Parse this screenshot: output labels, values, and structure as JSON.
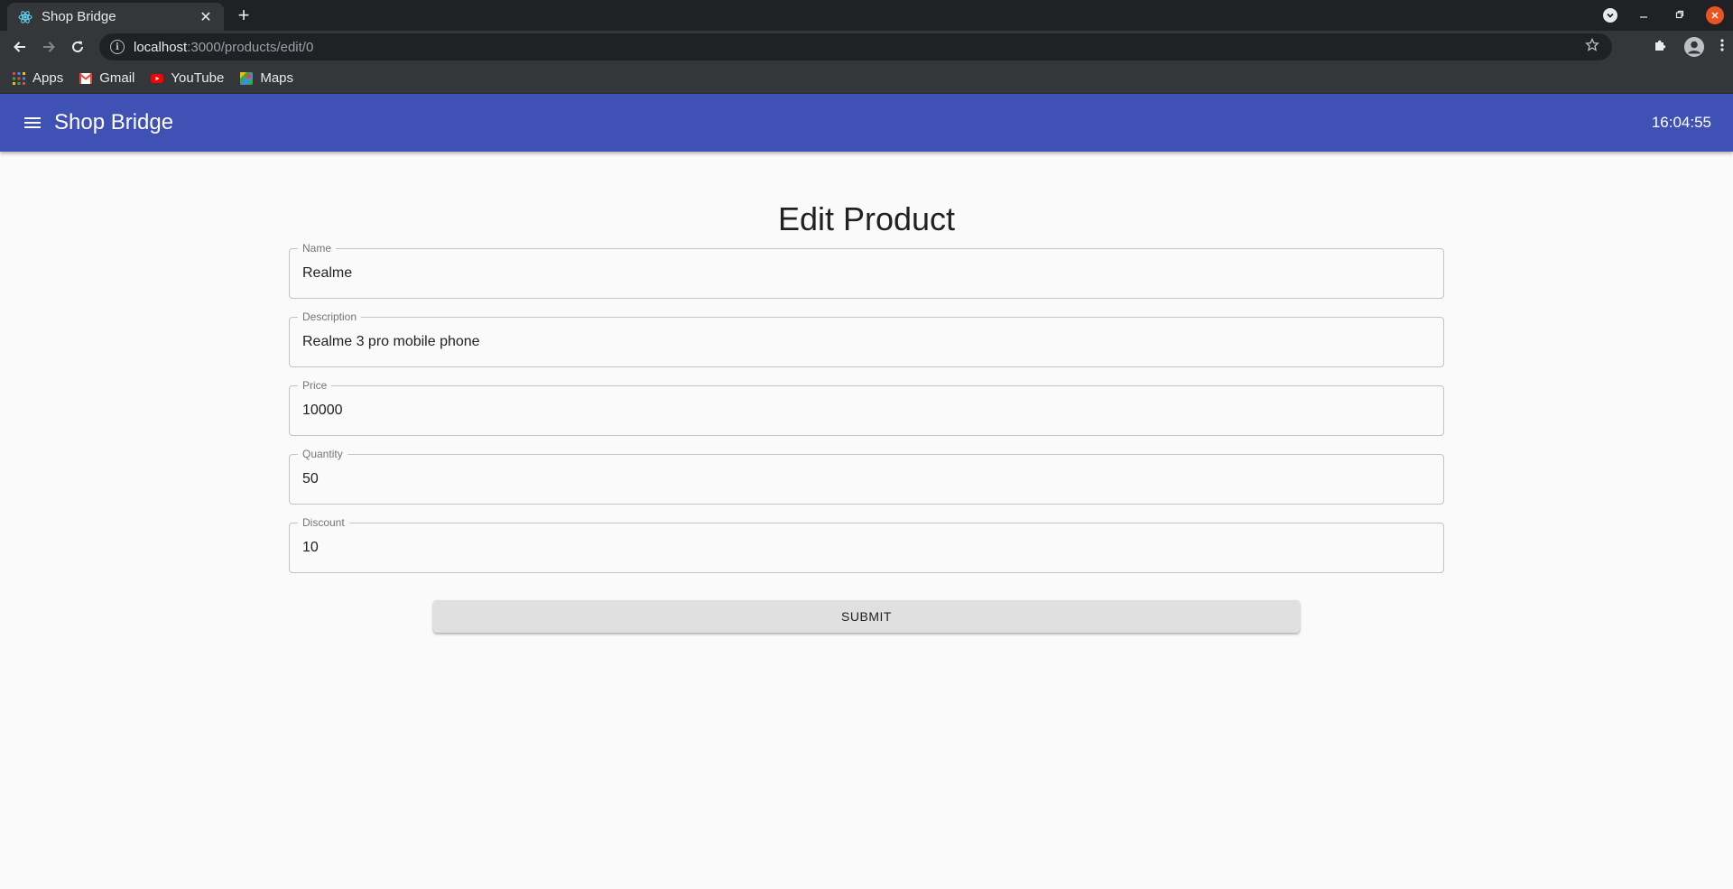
{
  "browser": {
    "tab_title": "Shop Bridge",
    "tab_close": "✕",
    "new_tab": "+",
    "url_host": "localhost",
    "url_path": ":3000/products/edit/0",
    "bookmarks": [
      {
        "label": "Apps",
        "icon": "apps-grid-icon"
      },
      {
        "label": "Gmail",
        "icon": "gmail-icon"
      },
      {
        "label": "YouTube",
        "icon": "youtube-icon"
      },
      {
        "label": "Maps",
        "icon": "maps-icon"
      }
    ]
  },
  "app": {
    "title": "Shop Bridge",
    "clock": "16:04:55",
    "primary_color": "#3f51b5"
  },
  "form": {
    "heading": "Edit Product",
    "fields": [
      {
        "label": "Name",
        "value": "Realme"
      },
      {
        "label": "Description",
        "value": "Realme 3 pro mobile phone"
      },
      {
        "label": "Price",
        "value": "10000"
      },
      {
        "label": "Quantity",
        "value": "50"
      },
      {
        "label": "Discount",
        "value": "10"
      }
    ],
    "submit_label": "SUBMIT"
  }
}
